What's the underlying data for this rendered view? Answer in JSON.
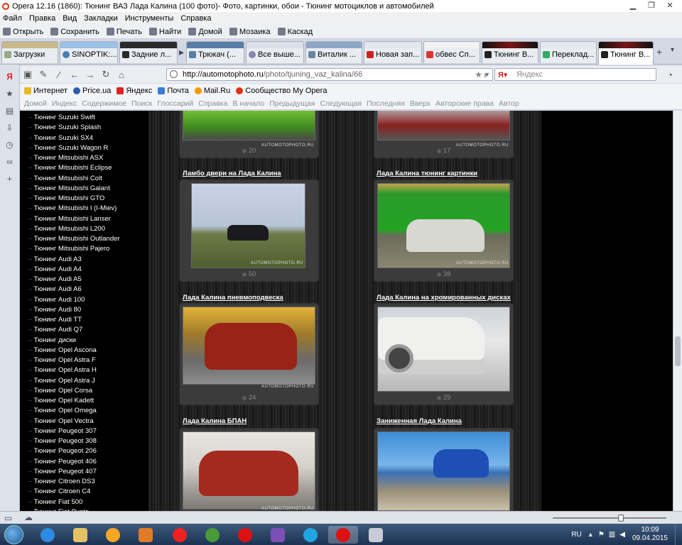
{
  "window": {
    "title": "Opera 12.16 (1860): Тюнинг ВАЗ Лада Калина (100 фото)- Фото, картинки, обои - Тюнинг мотоциклов и автомобилей"
  },
  "menu": [
    "Файл",
    "Правка",
    "Вид",
    "Закладки",
    "Инструменты",
    "Справка"
  ],
  "toolbar": [
    "Открыть",
    "Сохранить",
    "Печать",
    "Найти",
    "Домой",
    "Мозаика",
    "Каскад"
  ],
  "tabs": [
    {
      "label": "Загрузки",
      "color": "#9a8"
    },
    {
      "label": "SINOPTIK:...",
      "color": "#4a7bb5"
    },
    {
      "label": "Задние л...",
      "color": "#2a2a2a"
    },
    {
      "label": "Трюкач (...",
      "color": "#5a7da8"
    },
    {
      "label": "Все выше...",
      "color": "#88a"
    },
    {
      "label": "Виталик ...",
      "color": "#6a84a5"
    },
    {
      "label": "Новая зап...",
      "color": "#c22"
    },
    {
      "label": "обвес Сп...",
      "color": "#d33"
    },
    {
      "label": "Тюнинг В...",
      "color": "#222"
    },
    {
      "label": "Переклад...",
      "color": "#3a6"
    },
    {
      "label": "Тюнинг В...",
      "color": "#222"
    }
  ],
  "address": {
    "domain": "http://automotophoto.ru",
    "path": "/photo/tjuning_vaz_kalina/66",
    "search_placeholder": "Яндекс"
  },
  "bookmarks": [
    "Интернет",
    "Price.ua",
    "Яндекс",
    "Почта",
    "Mail.Ru",
    "Сообщество My Opera"
  ],
  "navlinks": [
    "Домой",
    "Индекс",
    "Содержимое",
    "Поиск",
    "Глоссарий",
    "Справка",
    "В начало",
    "Предыдущая",
    "Следующая",
    "Последняя",
    "Вверх",
    "Авторские права",
    "Автор"
  ],
  "sidebar_items": [
    "Тюнинг Suzuki Swift",
    "Тюнинг Suzuki Splash",
    "Тюнинг Suzuki SX4",
    "Тюнинг Suzuki Wagon R",
    "Тюнинг Mitsubishi ASX",
    "Тюнинг Mitsubishi Eclipse",
    "Тюнинг Mitsubishi Colt",
    "Тюнинг Mitsubishi Galant",
    "Тюнинг Mitsubishi GTO",
    "Тюнинг Mitsubishi I (I-Miev)",
    "Тюнинг Mitsubishi Lanser",
    "Тюнинг Mitsubishi L200",
    "Тюнинг Mitsubishi Outlander",
    "Тюнинг Mitsubishi Pajero",
    "Тюнинг Audi A3",
    "Тюнинг Audi A4",
    "Тюнинг Audi A5",
    "Тюнинг Audi A6",
    "Тюнинг Audi 100",
    "Тюнинг Audi 80",
    "Тюнинг Audi TT",
    "Тюнинг Audi Q7",
    "Тюнинг диски",
    "Тюнинг Opel Ascona",
    "Тюнинг Opel Astra F",
    "Тюнинг Opel Astra H",
    "Тюнинг Opel Astra J",
    "Тюнинг Opel Corsa",
    "Тюнинг Opel Kadett",
    "Тюнинг Opel Omega",
    "Тюнинг Opel Vectra",
    "Тюнинг Peugeot 307",
    "Тюнинг Peugeot 308",
    "Тюнинг Peugeot 206",
    "Тюнинг Peugeot 406",
    "Тюнинг Peugeot 407",
    "Тюнинг Citroen DS3",
    "Тюнинг Citroen C4",
    "Тюнинг Fiat 500",
    "Тюнинг Fiat Punto"
  ],
  "cards": [
    {
      "title": "",
      "count": "20",
      "watermark": "AUTOMOTOPHOTO.RU"
    },
    {
      "title": "",
      "count": "17",
      "watermark": "AUTOMOTOPHOTO.RU"
    },
    {
      "title": "Ламбо двери на Лада Калина",
      "count": "50",
      "watermark": "AUTOMOTOPHOTO.RU"
    },
    {
      "title": "Лада Калина тюнинг картинки",
      "count": "38",
      "watermark": "AUTOMOTOPHOTO.RU"
    },
    {
      "title": "Лада Калина пневмоподвеска",
      "count": "24",
      "watermark": "AUTOMOTOPHOTO.RU"
    },
    {
      "title": "Лада Калина на хромированных дисках",
      "count": "29",
      "watermark": ""
    },
    {
      "title": "Лада Калина БПАН",
      "count": "",
      "watermark": "AUTOMOTOPHOTO.RU"
    },
    {
      "title": "Заниженная Лада Калина",
      "count": "",
      "watermark": ""
    }
  ],
  "tray": {
    "lang": "RU",
    "time": "10:09",
    "date": "09.04.2015"
  }
}
